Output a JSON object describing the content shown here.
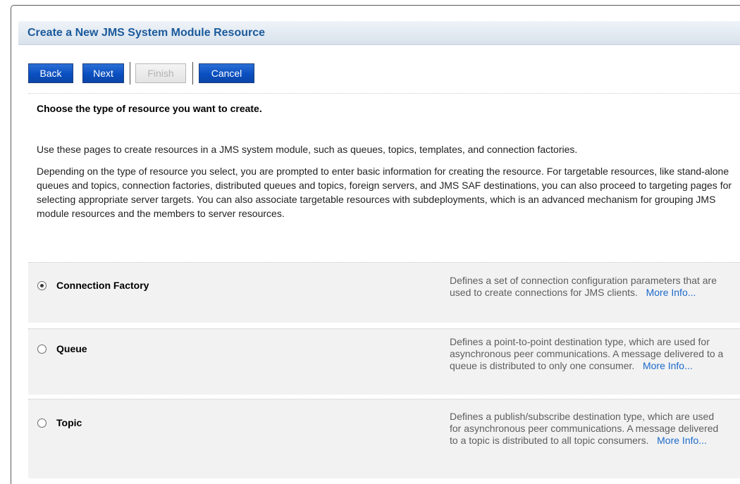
{
  "page": {
    "title": "Create a New JMS System Module Resource"
  },
  "toolbar": {
    "back_label": "Back",
    "next_label": "Next",
    "finish_label": "Finish",
    "cancel_label": "Cancel"
  },
  "instruction": "Choose the type of resource you want to create.",
  "intro": {
    "paragraph1": "Use these pages to create resources in a JMS system module, such as queues, topics, templates, and connection factories.",
    "paragraph2": "Depending on the type of resource you select, you are prompted to enter basic information for creating the resource. For targetable resources, like stand-alone queues and topics, connection factories, distributed queues and topics, foreign servers, and JMS SAF destinations, you can also proceed to targeting pages for selecting appropriate server targets. You can also associate targetable resources with subdeployments, which is an advanced mechanism for grouping JMS module resources and the members to server resources."
  },
  "options": [
    {
      "label": "Connection Factory",
      "description": "Defines a set of connection configuration parameters that are used to create connections for JMS clients.",
      "more_info": "More Info...",
      "selected": true
    },
    {
      "label": "Queue",
      "description": "Defines a point-to-point destination type, which are used for asynchronous peer communications. A message delivered to a queue is distributed to only one consumer.",
      "more_info": "More Info...",
      "selected": false
    },
    {
      "label": "Topic",
      "description": "Defines a publish/subscribe destination type, which are used for asynchronous peer communications. A message delivered to a topic is distributed to all topic consumers.",
      "more_info": "More Info...",
      "selected": false
    }
  ],
  "colors": {
    "title": "#1b5a9c",
    "button": "#0a4fc0",
    "link": "#1c6acb",
    "row_background": "#f2f2f2"
  }
}
